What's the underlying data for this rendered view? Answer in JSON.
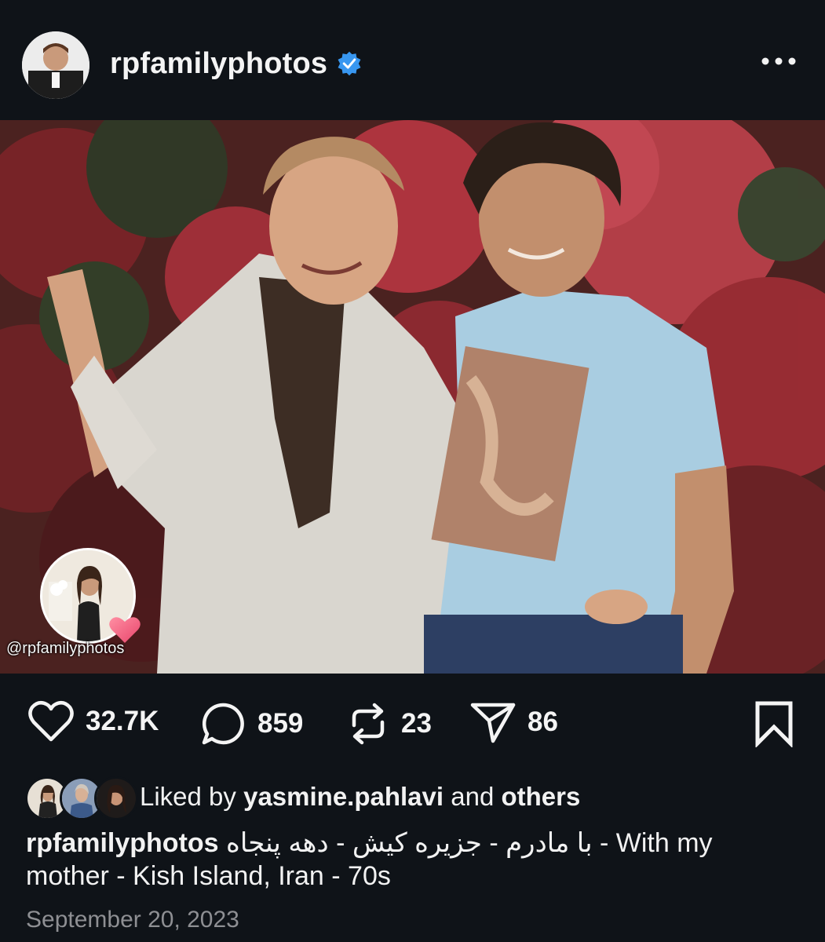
{
  "post": {
    "username": "rpfamilyphotos",
    "verified": true,
    "more_icon": "more-horizontal-icon"
  },
  "photo": {
    "watermark_text": "@rpfamilyphotos"
  },
  "actions": {
    "likes": "32.7K",
    "comments": "859",
    "reposts": "23",
    "shares": "86",
    "icons": [
      "heart-icon",
      "comment-icon",
      "repost-icon",
      "share-icon",
      "bookmark-icon"
    ]
  },
  "liked_by": {
    "prefix": "Liked by",
    "user": "yasmine.pahlavi",
    "conjunction": "and",
    "others": "others"
  },
  "caption": {
    "username": "rpfamilyphotos",
    "text_rtl": "با مادرم - جزیره کیش - دهه پنجاه",
    "text_ltr": " - With my mother - Kish Island, Iran - 70s"
  },
  "date": "September 20, 2023",
  "colors": {
    "background": "#0f1318",
    "verified_blue": "#3897f0",
    "text": "#f2f2f2",
    "muted": "#8e8f93"
  }
}
